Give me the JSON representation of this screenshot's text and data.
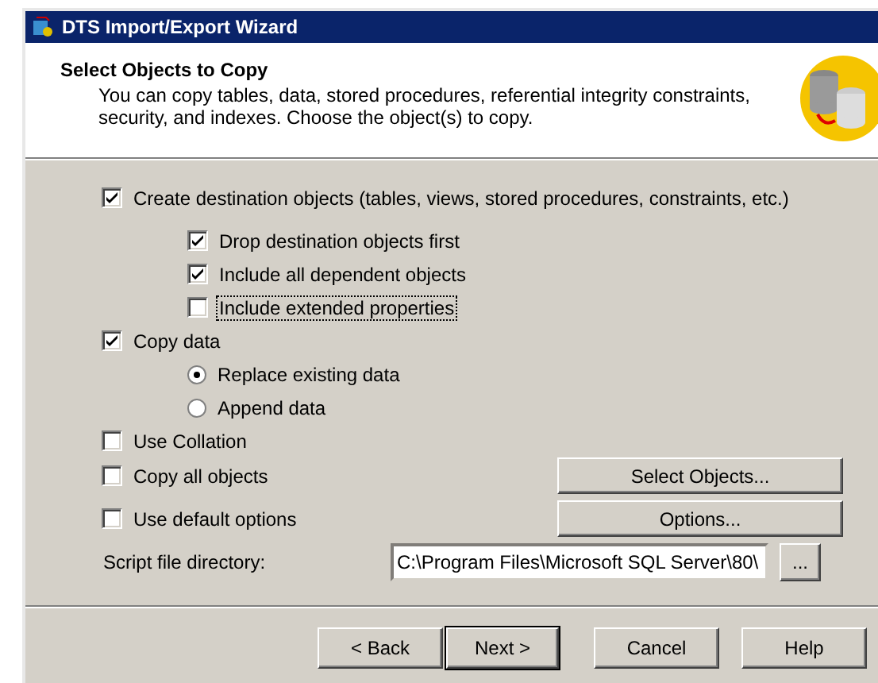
{
  "window": {
    "title": "DTS Import/Export Wizard"
  },
  "header": {
    "title": "Select Objects to Copy",
    "description": "You can copy tables, data, stored procedures, referential integrity constraints, security, and indexes.  Choose the object(s) to copy."
  },
  "options": [
    {
      "kind": "checkbox",
      "label": "Create destination objects (tables, views, stored procedures, constraints, etc.)",
      "checked": true,
      "focused": false,
      "children": [
        {
          "kind": "checkbox",
          "label": "Drop destination objects first",
          "checked": true,
          "focused": false
        },
        {
          "kind": "checkbox",
          "label": "Include all dependent objects",
          "checked": true,
          "focused": false
        },
        {
          "kind": "checkbox",
          "label": "Include extended properties",
          "checked": false,
          "focused": true
        }
      ]
    },
    {
      "kind": "checkbox",
      "label": "Copy data",
      "checked": true,
      "focused": false,
      "children": [
        {
          "kind": "radio",
          "label": "Replace existing data",
          "selected": true,
          "focused": false
        },
        {
          "kind": "radio",
          "label": "Append data",
          "selected": false,
          "focused": false
        }
      ]
    },
    {
      "kind": "checkbox",
      "label": "Use Collation",
      "checked": false,
      "focused": false
    }
  ],
  "object_options": [
    {
      "label": "Copy all objects",
      "checked": false,
      "button": "Select Objects..."
    },
    {
      "label": "Use default options",
      "checked": false,
      "button": "Options..."
    }
  ],
  "script_directory": {
    "label": "Script file directory:",
    "value": "C:\\Program Files\\Microsoft SQL Server\\80\\",
    "browse_button": "..."
  },
  "buttons": [
    {
      "label": "< Back",
      "default": false
    },
    {
      "label": "Next >",
      "default": true
    },
    {
      "label": "Cancel",
      "default": false
    },
    {
      "label": "Help",
      "default": false
    }
  ]
}
